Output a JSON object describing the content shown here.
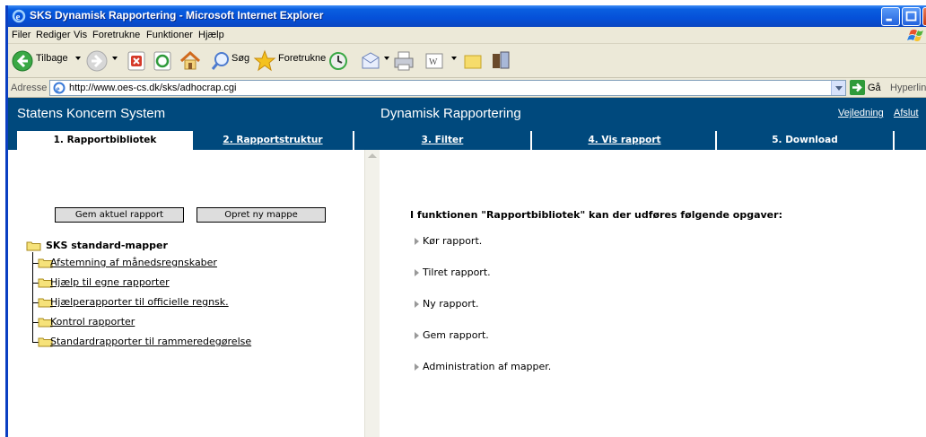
{
  "window": {
    "title": "SKS Dynamisk Rapportering - Microsoft Internet Explorer"
  },
  "menu": [
    "Filer",
    "Rediger",
    "Vis",
    "Foretrukne",
    "Funktioner",
    "Hjælp"
  ],
  "toolbar": {
    "back_label": "Tilbage",
    "search_label": "Søg",
    "favorites_label": "Foretrukne"
  },
  "address": {
    "label": "Adresse",
    "url": "http://www.oes-cs.dk/sks/adhocrap.cgi",
    "go_label": "Gå",
    "links_label": "Hyperlink"
  },
  "app": {
    "title": "Statens Koncern System",
    "module": "Dynamisk Rapportering",
    "help": "Vejledning",
    "logout": "Afslut"
  },
  "tabs": [
    "1. Rapportbibliotek",
    "2. Rapportstruktur",
    "3. Filter",
    "4. Vis rapport",
    "5. Download"
  ],
  "buttons": {
    "save_report": "Gem aktuel rapport",
    "new_folder": "Opret ny mappe"
  },
  "tree": {
    "root": "SKS standard-mapper",
    "items": [
      "Afstemning af månedsregnskaber",
      "Hjælp til egne rapporter",
      "Hjælperapporter til officielle regnsk.",
      "Kontrol rapporter",
      "Standardrapporter til rammeredegørelse"
    ]
  },
  "content": {
    "intro": "I funktionen \"Rapportbibliotek\" kan der udføres følgende opgaver:",
    "tasks": [
      "Kør rapport.",
      "Tilret rapport.",
      "Ny rapport.",
      "Gem rapport.",
      "Administration af mapper."
    ]
  },
  "colors": {
    "header_bg": "#00497d",
    "menu_bg": "#ece9d8",
    "titlebar": "#0550d8"
  }
}
